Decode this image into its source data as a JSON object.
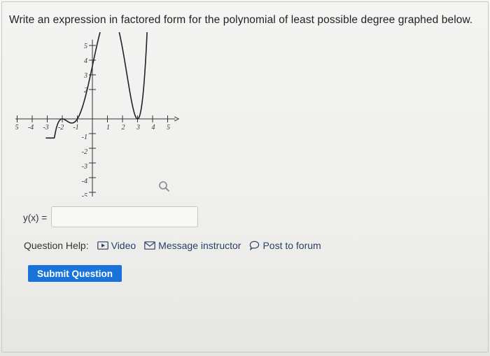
{
  "question": {
    "prompt": "Write an expression in factored form for the polynomial of least possible degree graphed below."
  },
  "graph": {
    "x_tick_labels": [
      "-5",
      "-4",
      "-3",
      "-2",
      "-1",
      "1",
      "2",
      "3",
      "4",
      "5"
    ],
    "y_tick_labels": [
      "5",
      "4",
      "3",
      "2",
      "-1",
      "-2",
      "-3",
      "-4",
      "-5"
    ],
    "xlim": [
      -5,
      5
    ],
    "ylim": [
      -5,
      5
    ],
    "curve_color": "#222222",
    "axis_color": "#333333"
  },
  "answer": {
    "label": "y(x) =",
    "value": ""
  },
  "help": {
    "label": "Question Help:",
    "video": "Video",
    "message": "Message instructor",
    "forum": "Post to forum"
  },
  "submit_label": "Submit Question",
  "colors": {
    "accent": "#1a73d9",
    "link": "#2c3e66"
  }
}
